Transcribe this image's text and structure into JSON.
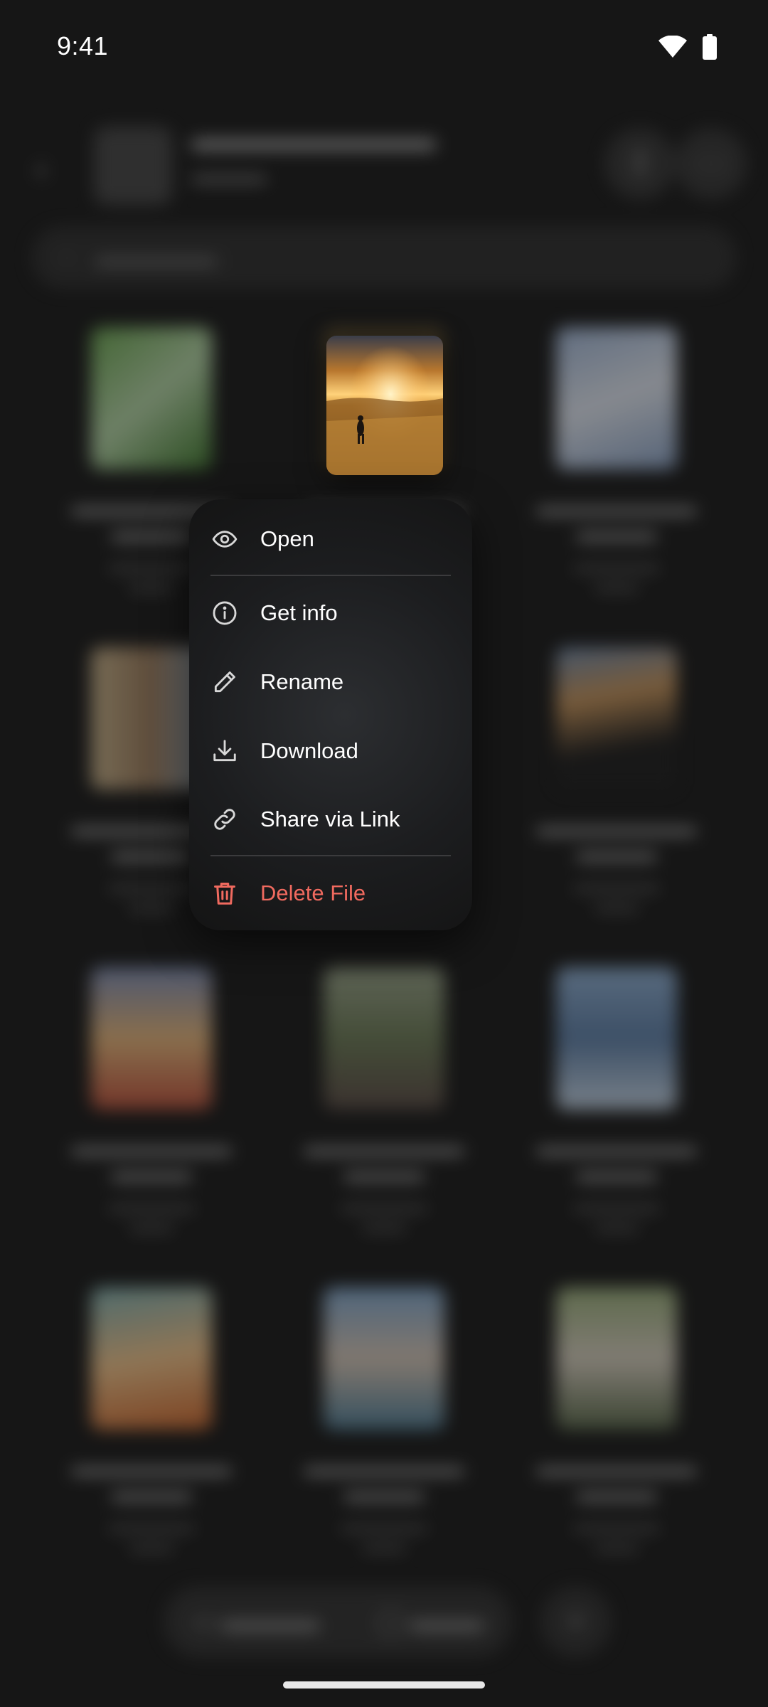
{
  "status": {
    "time": "9:41"
  },
  "menu": {
    "items": [
      {
        "label": "Open",
        "icon": "eye-icon"
      },
      {
        "label": "Get info",
        "icon": "info-icon"
      },
      {
        "label": "Rename",
        "icon": "pencil-icon"
      },
      {
        "label": "Download",
        "icon": "download-icon"
      },
      {
        "label": "Share via Link",
        "icon": "link-icon"
      },
      {
        "label": "Delete File",
        "icon": "trash-icon",
        "color": "#f06a5f"
      }
    ]
  },
  "colors": {
    "background": "#161616",
    "danger": "#f06a5f",
    "menu": "#1e1f21"
  }
}
